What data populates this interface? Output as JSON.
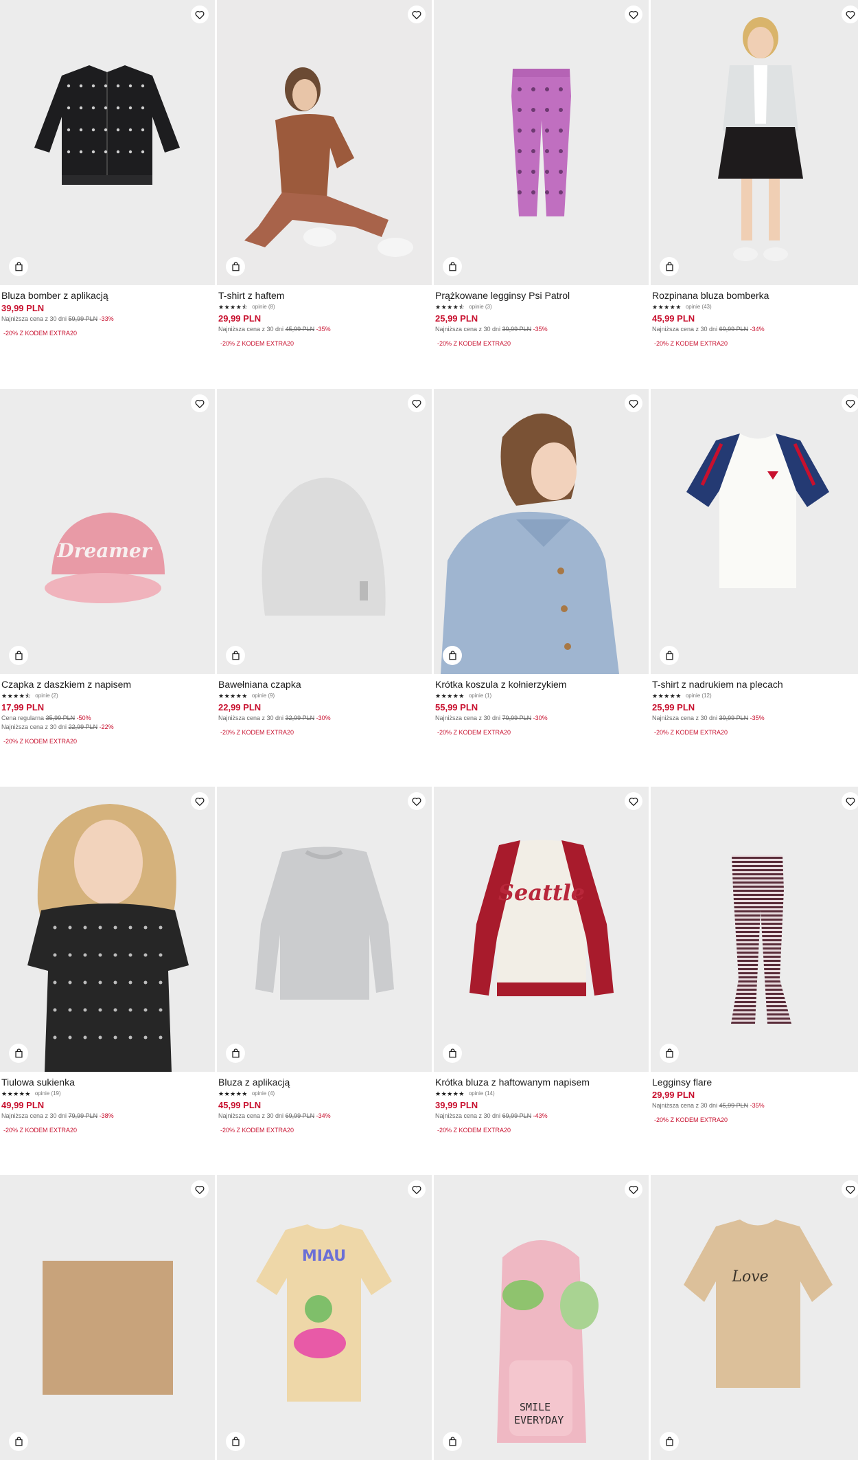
{
  "products": [
    {
      "name": "Bluza bomber z aplikacją",
      "stars": "",
      "reviews": "",
      "price": "39,99 PLN",
      "lowest_label": "Najniższa cena z 30 dni",
      "lowest_old": "59,99 PLN",
      "lowest_disc": "-33%",
      "regular_label": "",
      "regular_old": "",
      "regular_disc": "",
      "promo": "-20% Z KODEM EXTRA20",
      "bg": "#ececec",
      "image": "black-bomber-jacket"
    },
    {
      "name": "T-shirt z haftem",
      "stars": "★★★★⯪",
      "reviews": "opinie (8)",
      "price": "29,99 PLN",
      "lowest_label": "Najniższa cena z 30 dni",
      "lowest_old": "45,99 PLN",
      "lowest_disc": "-35%",
      "regular_label": "",
      "regular_old": "",
      "regular_disc": "",
      "promo": "-20% Z KODEM EXTRA20",
      "bg": "#ebeaea",
      "image": "girl-in-brown-set"
    },
    {
      "name": "Prążkowane legginsy Psi Patrol",
      "stars": "★★★★⯪",
      "reviews": "opinie (3)",
      "price": "25,99 PLN",
      "lowest_label": "Najniższa cena z 30 dni",
      "lowest_old": "39,99 PLN",
      "lowest_disc": "-35%",
      "regular_label": "",
      "regular_old": "",
      "regular_disc": "",
      "promo": "-20% Z KODEM EXTRA20",
      "bg": "#ececec",
      "image": "pink-leggings"
    },
    {
      "name": "Rozpinana bluza bomberka",
      "stars": "★★★★★",
      "reviews": "opinie (43)",
      "price": "45,99 PLN",
      "lowest_label": "Najniższa cena z 30 dni",
      "lowest_old": "69,99 PLN",
      "lowest_disc": "-34%",
      "regular_label": "",
      "regular_old": "",
      "regular_disc": "",
      "promo": "-20% Z KODEM EXTRA20",
      "bg": "#ebebeb",
      "image": "girl-in-grey-bomber"
    },
    {
      "name": "Czapka z daszkiem z napisem",
      "stars": "★★★★⯪",
      "reviews": "opinie (2)",
      "price": "17,99 PLN",
      "lowest_label": "Najniższa cena z 30 dni",
      "lowest_old": "22,99 PLN",
      "lowest_disc": "-22%",
      "regular_label": "Cena regularna",
      "regular_old": "35,99 PLN",
      "regular_disc": "-50%",
      "promo": "-20% Z KODEM EXTRA20",
      "bg": "#ececec",
      "image": "pink-cap"
    },
    {
      "name": "Bawełniana czapka",
      "stars": "★★★★★",
      "reviews": "opinie (9)",
      "price": "22,99 PLN",
      "lowest_label": "Najniższa cena z 30 dni",
      "lowest_old": "32,99 PLN",
      "lowest_disc": "-30%",
      "regular_label": "",
      "regular_old": "",
      "regular_disc": "",
      "promo": "-20% Z KODEM EXTRA20",
      "bg": "#ececec",
      "image": "grey-beanie"
    },
    {
      "name": "Krótka koszula z kołnierzykiem",
      "stars": "★★★★★",
      "reviews": "opinie (1)",
      "price": "55,99 PLN",
      "lowest_label": "Najniższa cena z 30 dni",
      "lowest_old": "79,99 PLN",
      "lowest_disc": "-30%",
      "regular_label": "",
      "regular_old": "",
      "regular_disc": "",
      "promo": "-20% Z KODEM EXTRA20",
      "bg": "#ebebeb",
      "image": "girl-in-denim-shirt"
    },
    {
      "name": "T-shirt z nadrukiem na plecach",
      "stars": "★★★★★",
      "reviews": "opinie (12)",
      "price": "25,99 PLN",
      "lowest_label": "Najniższa cena z 30 dni",
      "lowest_old": "39,99 PLN",
      "lowest_disc": "-35%",
      "regular_label": "",
      "regular_old": "",
      "regular_disc": "",
      "promo": "-20% Z KODEM EXTRA20",
      "bg": "#ececec",
      "image": "white-raglan-tshirt"
    },
    {
      "name": "Tiulowa sukienka",
      "stars": "★★★★★",
      "reviews": "opinie (19)",
      "price": "49,99 PLN",
      "lowest_label": "Najniższa cena z 30 dni",
      "lowest_old": "79,99 PLN",
      "lowest_disc": "-38%",
      "regular_label": "",
      "regular_old": "",
      "regular_disc": "",
      "promo": "-20% Z KODEM EXTRA20",
      "bg": "#ebebeb",
      "image": "girl-in-tulle-dress"
    },
    {
      "name": "Bluza z aplikacją",
      "stars": "★★★★★",
      "reviews": "opinie (4)",
      "price": "45,99 PLN",
      "lowest_label": "Najniższa cena z 30 dni",
      "lowest_old": "69,99 PLN",
      "lowest_disc": "-34%",
      "regular_label": "",
      "regular_old": "",
      "regular_disc": "",
      "promo": "-20% Z KODEM EXTRA20",
      "bg": "#ececec",
      "image": "grey-sweatshirt"
    },
    {
      "name": "Krótka bluza z haftowanym napisem",
      "stars": "★★★★★",
      "reviews": "opinie (14)",
      "price": "39,99 PLN",
      "lowest_label": "Najniższa cena z 30 dni",
      "lowest_old": "69,99 PLN",
      "lowest_disc": "-43%",
      "regular_label": "",
      "regular_old": "",
      "regular_disc": "",
      "promo": "-20% Z KODEM EXTRA20",
      "bg": "#ececec",
      "image": "seattle-sweatshirt"
    },
    {
      "name": "Legginsy flare",
      "stars": "",
      "reviews": "",
      "price": "29,99 PLN",
      "lowest_label": "Najniższa cena z 30 dni",
      "lowest_old": "45,99 PLN",
      "lowest_disc": "-35%",
      "regular_label": "",
      "regular_old": "",
      "regular_disc": "",
      "promo": "-20% Z KODEM EXTRA20",
      "bg": "#ececec",
      "image": "striped-flare-leggings"
    },
    {
      "name": "",
      "stars": "",
      "reviews": "",
      "price": "",
      "lowest_label": "",
      "lowest_old": "",
      "lowest_disc": "",
      "regular_label": "",
      "regular_old": "",
      "regular_disc": "",
      "promo": "",
      "bg": "#ececec",
      "image": "beige-snood"
    },
    {
      "name": "",
      "stars": "",
      "reviews": "",
      "price": "",
      "lowest_label": "",
      "lowest_old": "",
      "lowest_disc": "",
      "regular_label": "",
      "regular_old": "",
      "regular_disc": "",
      "promo": "",
      "bg": "#ececec",
      "image": "beige-tshirt-frog"
    },
    {
      "name": "",
      "stars": "",
      "reviews": "",
      "price": "",
      "lowest_label": "",
      "lowest_old": "",
      "lowest_disc": "",
      "regular_label": "",
      "regular_old": "",
      "regular_disc": "",
      "promo": "",
      "bg": "#ececec",
      "image": "pink-frog-backpack"
    },
    {
      "name": "",
      "stars": "",
      "reviews": "",
      "price": "",
      "lowest_label": "",
      "lowest_old": "",
      "lowest_disc": "",
      "regular_label": "",
      "regular_old": "",
      "regular_disc": "",
      "promo": "",
      "bg": "#ececec",
      "image": "beige-tshirt-print"
    }
  ],
  "art": {
    "bomber_text": "",
    "cap_text": "Dreamer",
    "sweat_text": "Seattle",
    "backpack_text1": "SMILE",
    "backpack_text2": "EVERYDAY",
    "tee_text": "Love"
  },
  "colors": {
    "price": "#c8102e",
    "text": "#1c1c1c",
    "muted": "#666666",
    "image_bg": "#ececec"
  }
}
